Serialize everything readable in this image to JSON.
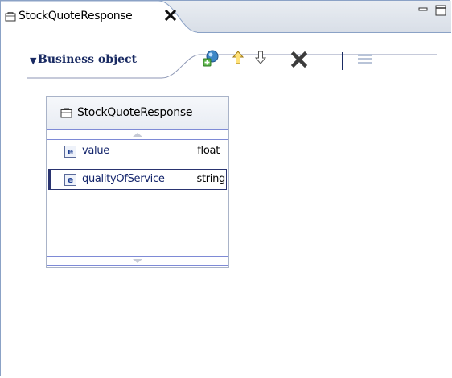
{
  "editor_tab": {
    "title": "StockQuoteResponse",
    "tab_icon": "business-object-icon",
    "close_icon": "close-icon"
  },
  "window_controls": {
    "minimize_icon": "minimize-icon",
    "maximize_icon": "maximize-icon"
  },
  "section": {
    "title": "Business object",
    "toggle_icon": "expand-triangle-icon",
    "toolbar": [
      {
        "name": "add-attribute-button",
        "icon": "add-attribute-icon"
      },
      {
        "name": "move-up-button",
        "icon": "arrow-up-icon"
      },
      {
        "name": "move-down-button",
        "icon": "arrow-down-icon"
      },
      {
        "name": "delete-button",
        "icon": "delete-x-icon"
      },
      {
        "name": "layout-button",
        "icon": "layout-lines-icon"
      }
    ]
  },
  "business_object": {
    "name": "StockQuoteResponse",
    "attributes": [
      {
        "icon": "e",
        "name": "value",
        "type": "float",
        "selected": false
      },
      {
        "icon": "e",
        "name": "qualityOfService",
        "type": "string",
        "selected": true
      }
    ]
  },
  "colors": {
    "border": "#8ba2c6",
    "title_text": "#1a2b63",
    "attribute_name": "#13246b",
    "selection": "#2a3470",
    "scroll_border": "#7e8ad6"
  }
}
